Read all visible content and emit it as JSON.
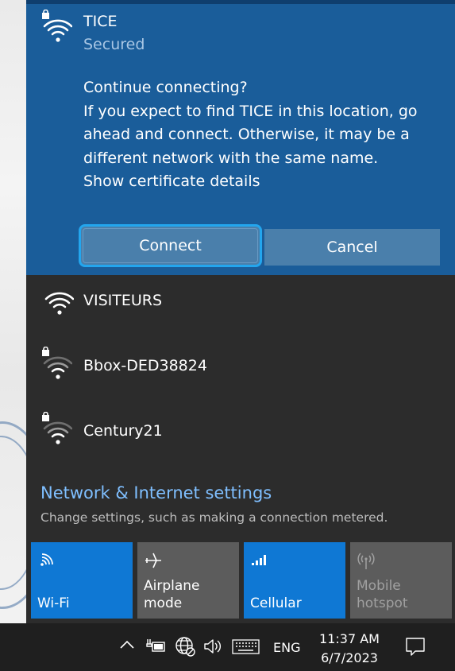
{
  "selected_network": {
    "name": "TICE",
    "status": "Secured",
    "message_lines": [
      "Continue connecting?",
      "If you expect to find TICE in this location, go",
      "ahead and connect. Otherwise, it may be a",
      "different network with the same name.",
      "Show certificate details"
    ],
    "connect_label": "Connect",
    "cancel_label": "Cancel"
  },
  "networks": [
    {
      "name": "VISITEURS",
      "secured": false
    },
    {
      "name": "Bbox-DED38824",
      "secured": true
    },
    {
      "name": "Century21",
      "secured": true
    }
  ],
  "settings": {
    "link": "Network & Internet settings",
    "description": "Change settings, such as making a connection metered."
  },
  "quick_actions": [
    {
      "label_lines": [
        "Wi-Fi"
      ],
      "state": "on",
      "icon": "wifi-icon"
    },
    {
      "label_lines": [
        "Airplane mode"
      ],
      "state": "off",
      "icon": "airplane-icon"
    },
    {
      "label_lines": [
        "Cellular"
      ],
      "state": "on",
      "icon": "cellular-icon"
    },
    {
      "label_lines": [
        "Mobile",
        "hotspot"
      ],
      "state": "disabled",
      "icon": "hotspot-icon"
    }
  ],
  "taskbar": {
    "language": "ENG",
    "time": "11:37 AM",
    "date": "6/7/2023"
  },
  "colors": {
    "accent": "#0f78d4",
    "expanded_bg": "#1a5d9a",
    "flyout_bg": "#2c2c2c",
    "link": "#7fbfff"
  }
}
